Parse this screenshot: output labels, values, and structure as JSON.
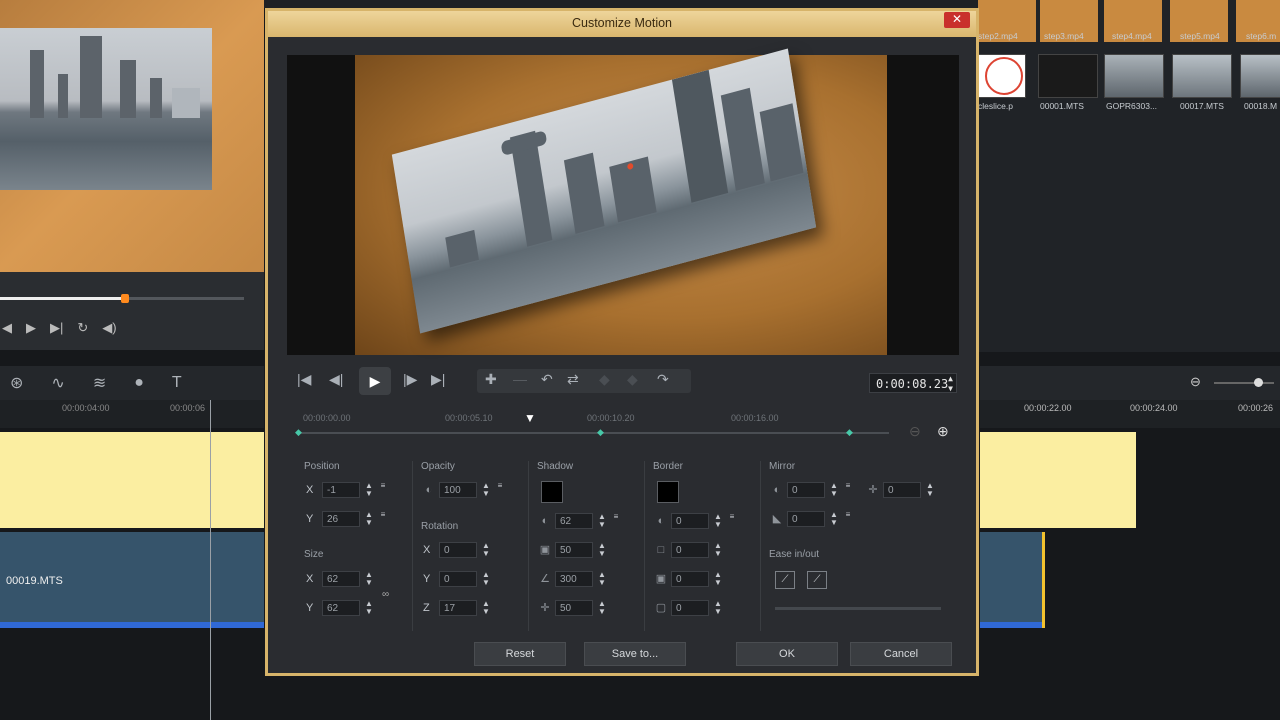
{
  "dialog": {
    "title": "Customize Motion",
    "close_icon": "close-icon",
    "timecode": "0:00:08.23",
    "ruler_labels": [
      "00:00:00.00",
      "00:00:05.10",
      "00:00:10.20",
      "00:00:16.00"
    ],
    "position": {
      "label": "Position",
      "x": "-1",
      "y": "26"
    },
    "size": {
      "label": "Size",
      "x": "62",
      "y": "62"
    },
    "opacity": {
      "label": "Opacity",
      "value": "100"
    },
    "rotation": {
      "label": "Rotation",
      "x": "0",
      "y": "0",
      "z": "17"
    },
    "shadow": {
      "label": "Shadow",
      "color": "#000000",
      "v1": "62",
      "v2": "50",
      "v3": "300",
      "v4": "50"
    },
    "border": {
      "label": "Border",
      "color": "#000000",
      "v1": "0",
      "v2": "0",
      "v3": "0",
      "v4": "0"
    },
    "mirror": {
      "label": "Mirror",
      "v1": "0",
      "v2": "0",
      "v3": "0"
    },
    "ease": {
      "label": "Ease in/out"
    },
    "buttons": {
      "reset": "Reset",
      "save_to": "Save to...",
      "ok": "OK",
      "cancel": "Cancel"
    },
    "axis": {
      "x": "X",
      "y": "Y",
      "z": "Z"
    }
  },
  "background": {
    "ruler_left": [
      "00:00:04:00",
      "00:00:06"
    ],
    "ruler_right": [
      "00:00:22.00",
      "00:00:24.00",
      "00:00:26"
    ],
    "clip_name": "00019.MTS",
    "thumb_labels": [
      "step2.mp4",
      "step3.mp4",
      "step4.mp4",
      "step5.mp4",
      "step6.m",
      "cleslice.p",
      "00001.MTS",
      "GOPR6303...",
      "00017.MTS",
      "00018.M"
    ]
  },
  "colors": {
    "dialog_border": "#d7b46a",
    "keyframe": "#47c8a8",
    "scrub_knob": "#ff8a1e",
    "timeline_yellow": "#fbeea1",
    "clip_blue": "#36546b"
  }
}
